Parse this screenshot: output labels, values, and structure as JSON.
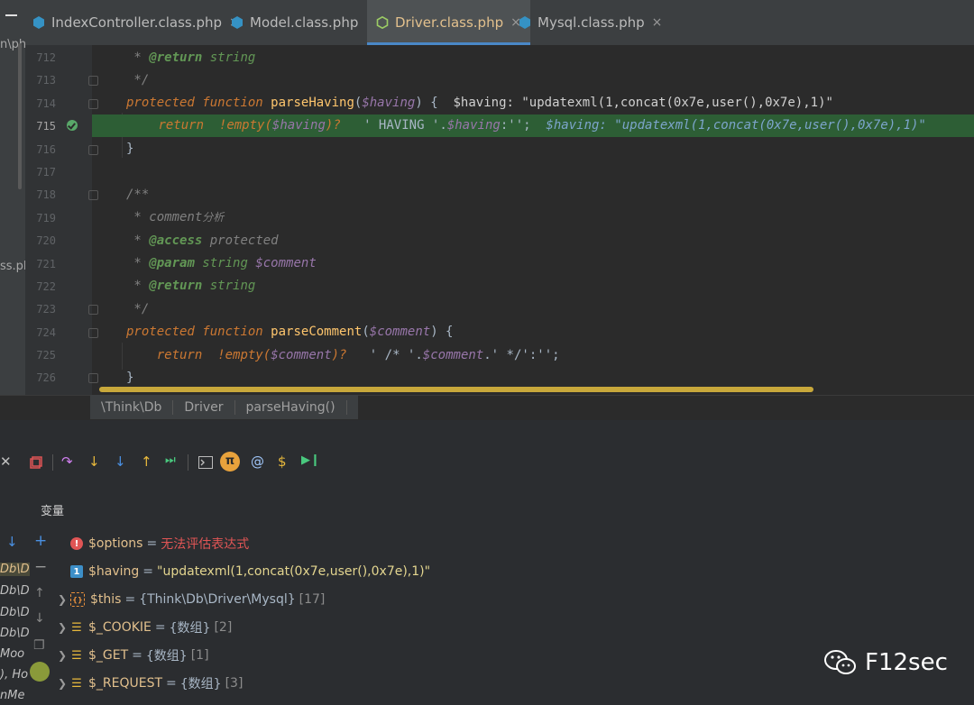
{
  "left_strip": {
    "frag1": "n\\ph",
    "frag2": "ss.pl"
  },
  "tabs": [
    {
      "label": "IndexController.class.php",
      "active": false
    },
    {
      "label": "Model.class.php",
      "active": false
    },
    {
      "label": "Driver.class.php",
      "active": true
    },
    {
      "label": "Mysql.class.php",
      "active": false
    }
  ],
  "tab_close": "×",
  "code": {
    "line_numbers": [
      "712",
      "713",
      "714",
      "715",
      "716",
      "717",
      "718",
      "719",
      "720",
      "721",
      "722",
      "723",
      "724",
      "725",
      "726"
    ],
    "current_line": "715",
    "l712": {
      "a": " * ",
      "tag": "@return",
      "b": " string"
    },
    "l713": " */",
    "l714": {
      "kw1": "protected",
      "kw2": "function",
      "fn": "parseHaving",
      "p1": "(",
      "var": "$having",
      "p2": ") {",
      "inline": "$having: \"updatexml(1,concat(0x7e,user(),0x7e),1)\""
    },
    "l715": {
      "kw": "return",
      "neg": "!",
      "fn": "empty",
      "p1": "(",
      "var": "$having",
      "p2": ")?",
      "s1": "' HAVING '",
      "dot1": ".",
      "var2": "$having",
      "dot2": ":",
      "s2": "''",
      "semi": ";",
      "inline": "$having: \"updatexml(1,concat(0x7e,user(),0x7e),1)\""
    },
    "l716": "}",
    "l718": "/**",
    "l719": {
      "a": " * comment",
      "b": "分析"
    },
    "l720": {
      "a": " * ",
      "tag": "@access",
      "b": " protected"
    },
    "l721": {
      "a": " * ",
      "tag": "@param",
      "b": " string ",
      "var": "$comment"
    },
    "l722": {
      "a": " * ",
      "tag": "@return",
      "b": " string"
    },
    "l723": " */",
    "l724": {
      "kw1": "protected",
      "kw2": "function",
      "fn": "parseComment",
      "p1": "(",
      "var": "$comment",
      "p2": ") {"
    },
    "l725": {
      "kw": "return",
      "neg": "!",
      "fn": "empty",
      "p1": "(",
      "var": "$comment",
      "p2": ")?",
      "s1": "' /* '",
      "dot1": ".",
      "var2": "$comment",
      "dot2": ".",
      "s2": "' */'",
      "colon": ":",
      "s3": "''",
      "semi": ";"
    },
    "l726": "}"
  },
  "breadcrumb": [
    "\\Think\\Db",
    "Driver",
    "parseHaving()"
  ],
  "debug": {
    "variables_title": "变量",
    "side_frags": [
      "Db\\D",
      "Db\\D",
      "Db\\D",
      "Db\\D",
      "Moo",
      "), Ho",
      "nMe"
    ],
    "vars": [
      {
        "name": "$options",
        "eq": "=",
        "value": "无法评估表达式",
        "kind": "error",
        "meta": ""
      },
      {
        "name": "$having",
        "eq": "=",
        "value": "\"updatexml(1,concat(0x7e,user(),0x7e),1)\"",
        "kind": "string",
        "meta": ""
      },
      {
        "name": "$this",
        "eq": "=",
        "value": "{Think\\Db\\Driver\\Mysql}",
        "kind": "object",
        "meta": "[17]"
      },
      {
        "name": "$_COOKIE",
        "eq": "=",
        "value": "{数组}",
        "kind": "array",
        "meta": "[2]"
      },
      {
        "name": "$_GET",
        "eq": "=",
        "value": "{数组}",
        "kind": "array",
        "meta": "[1]"
      },
      {
        "name": "$_REQUEST",
        "eq": "=",
        "value": "{数组}",
        "kind": "array",
        "meta": "[3]"
      }
    ]
  },
  "watermark": "F12sec",
  "colors": {
    "accent_tab": "#4a88c7",
    "exec_line": "#2d5e35",
    "keyword": "#cc7832",
    "variable": "#9876aa",
    "function": "#ffc66d"
  }
}
